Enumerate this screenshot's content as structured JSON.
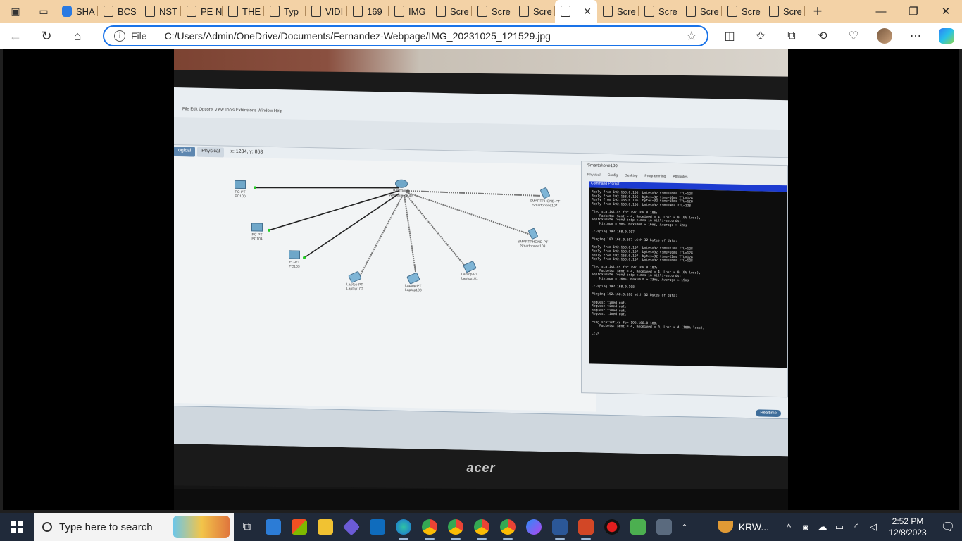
{
  "browser": {
    "tabs": [
      {
        "label": "SHA",
        "favicon": "blue-app-icon"
      },
      {
        "label": "BCS",
        "favicon": "document-icon"
      },
      {
        "label": "NST",
        "favicon": "document-icon"
      },
      {
        "label": "PE N",
        "favicon": "pdf-icon"
      },
      {
        "label": "THE",
        "favicon": "pdf-icon"
      },
      {
        "label": "Typ",
        "favicon": "document-icon"
      },
      {
        "label": "VIDI",
        "favicon": "pdf-icon"
      },
      {
        "label": "169",
        "favicon": "document-icon"
      },
      {
        "label": "IMG",
        "favicon": "document-icon"
      },
      {
        "label": "Scre",
        "favicon": "document-icon"
      },
      {
        "label": "Scre",
        "favicon": "document-icon"
      },
      {
        "label": "Scre",
        "favicon": "document-icon"
      },
      {
        "label": "",
        "favicon": "document-icon",
        "active": true
      },
      {
        "label": "Scre",
        "favicon": "document-icon"
      },
      {
        "label": "Scre",
        "favicon": "document-icon"
      },
      {
        "label": "Scre",
        "favicon": "document-icon"
      },
      {
        "label": "Scre",
        "favicon": "document-icon"
      },
      {
        "label": "Scre",
        "favicon": "document-icon"
      }
    ],
    "address": {
      "scheme_label": "File",
      "url": "C:/Users/Admin/OneDrive/Documents/Fernandez-Webpage/IMG_20231025_121529.jpg"
    },
    "theme_color": "#f3d2a6",
    "focus_color": "#1a73e8"
  },
  "photo": {
    "pt": {
      "mode_tabs": [
        "ogical",
        "Physical"
      ],
      "coords": "x: 1234, y: 868",
      "devices": [
        {
          "type": "PC-PT",
          "name": "PC100"
        },
        {
          "type": "PC-PT",
          "name": "PC104"
        },
        {
          "type": "PC-PT",
          "name": "PC103"
        },
        {
          "type": "WRT300N",
          "name": "Wireless Router"
        },
        {
          "type": "Laptop-PT",
          "name": "Laptop102"
        },
        {
          "type": "Laptop-PT",
          "name": "Laptop103"
        },
        {
          "type": "Laptop-PT",
          "name": "Laptop101"
        },
        {
          "type": "SMARTPHONE-PT",
          "name": "Smartphone107"
        },
        {
          "type": "SMARTPHONE-PT",
          "name": "Smartphone108"
        }
      ],
      "cmd_window": {
        "title": "Smartphone100",
        "tabs": [
          "Physical",
          "Config",
          "Desktop",
          "Programming",
          "Attributes"
        ],
        "header": "Command Prompt",
        "lines": [
          "Reply from 192.168.0.106: bytes=32 time=16ms TTL=128",
          "Reply from 192.168.0.106: bytes=32 time=10ms TTL=128",
          "Reply from 192.168.0.106: bytes=32 time=15ms TTL=128",
          "Reply from 192.168.0.106: bytes=32 time=9ms TTL=128",
          "",
          "Ping statistics for 192.168.0.106:",
          "    Packets: Sent = 4, Received = 4, Lost = 0 (0% loss),",
          "Approximate round trip times in milli-seconds:",
          "    Minimum = 9ms, Maximum = 16ms, Average = 12ms",
          "",
          "C:\\>ping 192.168.0.107",
          "",
          "Pinging 192.168.0.107 with 32 bytes of data:",
          "",
          "Reply from 192.168.0.107: bytes=32 time=23ms TTL=128",
          "Reply from 192.168.0.107: bytes=32 time=16ms TTL=128",
          "Reply from 192.168.0.107: bytes=32 time=22ms TTL=128",
          "Reply from 192.168.0.107: bytes=32 time=16ms TTL=128",
          "",
          "Ping statistics for 192.168.0.107:",
          "    Packets: Sent = 4, Received = 4, Lost = 0 (0% loss),",
          "Approximate round trip times in milli-seconds:",
          "    Minimum = 16ms, Maximum = 23ms, Average = 19ms",
          "",
          "C:\\>ping 192.168.0.108",
          "",
          "Pinging 192.168.0.108 with 32 bytes of data:",
          "",
          "Request timed out.",
          "Request timed out.",
          "Request timed out.",
          "Request timed out.",
          "",
          "Ping statistics for 192.168.0.108:",
          "    Packets: Sent = 4, Received = 0, Lost = 4 (100% loss),",
          "",
          "C:\\>"
        ]
      },
      "realtime_label": "Realtime"
    },
    "monitor_brand": "acer"
  },
  "taskbar": {
    "search_placeholder": "Type here to search",
    "tray_app_label": "KRW...",
    "time": "2:52 PM",
    "date": "12/8/2023"
  }
}
